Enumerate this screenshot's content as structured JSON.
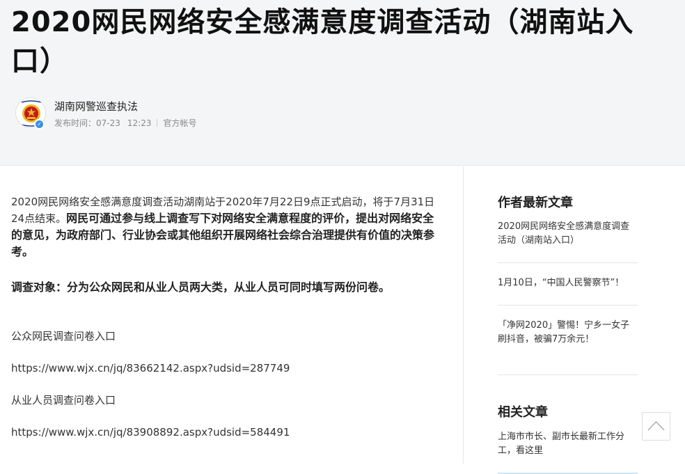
{
  "article": {
    "title": "2020网民网络安全感满意度调查活动（湖南站入口）",
    "author": "湖南网警巡查执法",
    "publish_label": "发布时间：",
    "publish_date": "07-23",
    "publish_time": "12:23",
    "account_type": "官方帐号"
  },
  "content": {
    "p1_normal": "2020网民网络安全感满意度调查活动湖南站于2020年7月22日9点正式启动，将于7月31日24点结束。",
    "p1_bold": "网民可通过参与线上调查写下对网络安全满意程度的评价，提出对网络安全的意见，为政府部门、行业协会或其他组织开展网络社会综合治理提供有价值的决策参考。",
    "p2_bold": "调查对象：分为公众网民和从业人员两大类，从业人员可同时填写两份问卷。",
    "p3": "公众网民调查问卷入口",
    "p4": "https://www.wjx.cn/jq/83662142.aspx?udsid=287749",
    "p5": "从业人员调查问卷入口",
    "p6": "https://www.wjx.cn/jq/83908892.aspx?udsid=584491"
  },
  "sidebar": {
    "latest_title": "作者最新文章",
    "latest_items": [
      "2020网民网络安全感满意度调查活动（湖南站入口）",
      "1月10日，“中国人民警察节”！",
      "「净网2020」警惕！宁乡一女子刷抖音，被骗7万余元！"
    ],
    "related_title": "相关文章",
    "related_items": [
      "上海市市长、副市长最新工作分工，看这里"
    ]
  },
  "colors": {
    "header_bg": "#f4f5f6",
    "verified": "#3a8ee6",
    "emblem_red": "#c8161d",
    "emblem_gold": "#e8b923"
  },
  "icons": {
    "avatar": "police-emblem-icon",
    "verified": "verified-check-icon",
    "back_to_top": "chevron-up-icon"
  }
}
